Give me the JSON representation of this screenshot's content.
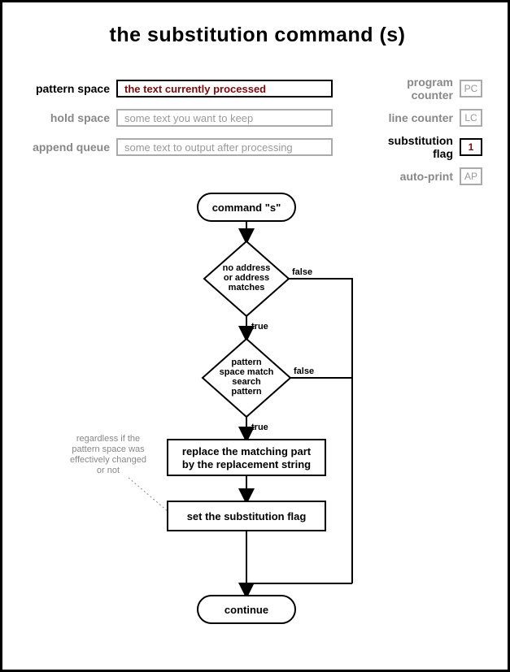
{
  "title": "the substitution command (s)",
  "fields": {
    "pattern_space": {
      "label": "pattern space",
      "value": "the text currently processed",
      "active": true
    },
    "hold_space": {
      "label": "hold space",
      "value": "some text you want to keep",
      "active": false
    },
    "append_queue": {
      "label": "append queue",
      "value": "some text to output after processing",
      "active": false
    },
    "program_counter": {
      "label": "program counter",
      "badge": "PC",
      "active": false
    },
    "line_counter": {
      "label": "line counter",
      "badge": "LC",
      "active": false
    },
    "substitution_flag": {
      "label": "substitution flag",
      "badge": "1",
      "active": true
    },
    "auto_print": {
      "label": "auto-print",
      "badge": "AP",
      "active": false
    }
  },
  "flow": {
    "start": "command \"s\"",
    "dec1_line1": "no address",
    "dec1_line2": "or address",
    "dec1_line3": "matches",
    "dec2_line1": "pattern",
    "dec2_line2": "space match",
    "dec2_line3": "search",
    "dec2_line4": "pattern",
    "box1_line1": "replace the matching part",
    "box1_line2": "by the replacement string",
    "box2": "set the substitution flag",
    "end": "continue",
    "true": "true",
    "false": "false",
    "note_line1": "regardless if the",
    "note_line2": "pattern space was",
    "note_line3": "effectively changed",
    "note_line4": "or not"
  }
}
